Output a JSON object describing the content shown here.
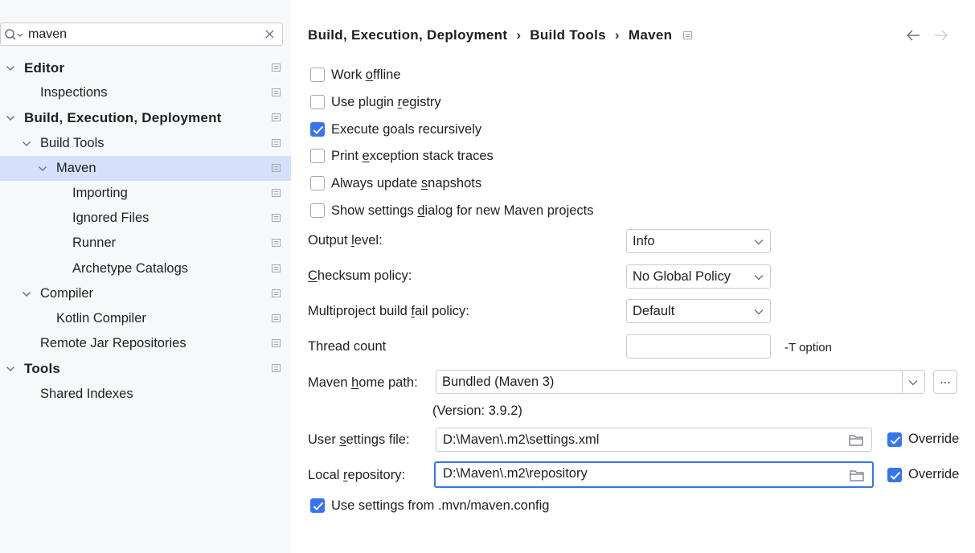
{
  "search": {
    "value": "maven"
  },
  "tree": [
    {
      "label": "Editor",
      "bold": true,
      "chevron": "down",
      "level": 0
    },
    {
      "label": "Inspections",
      "bold": false,
      "chevron": "",
      "level": 1
    },
    {
      "label": "Build, Execution, Deployment",
      "bold": true,
      "chevron": "down",
      "level": 0
    },
    {
      "label": "Build Tools",
      "bold": false,
      "chevron": "down",
      "level": 1
    },
    {
      "label": "Maven",
      "bold": false,
      "chevron": "down",
      "level": 2,
      "selected": true
    },
    {
      "label": "Importing",
      "bold": false,
      "chevron": "",
      "level": 3
    },
    {
      "label": "Ignored Files",
      "bold": false,
      "chevron": "",
      "level": 3
    },
    {
      "label": "Runner",
      "bold": false,
      "chevron": "",
      "level": 3
    },
    {
      "label": "Archetype Catalogs",
      "bold": false,
      "chevron": "",
      "level": 3
    },
    {
      "label": "Compiler",
      "bold": false,
      "chevron": "down",
      "level": 1
    },
    {
      "label": "Kotlin Compiler",
      "bold": false,
      "chevron": "",
      "level": 2
    },
    {
      "label": "Remote Jar Repositories",
      "bold": false,
      "chevron": "",
      "level": 1
    },
    {
      "label": "Tools",
      "bold": true,
      "chevron": "down",
      "level": 0
    },
    {
      "label": "Shared Indexes",
      "bold": false,
      "chevron": "",
      "level": 1
    }
  ],
  "breadcrumb": {
    "items": [
      "Build, Execution, Deployment",
      "Build Tools",
      "Maven"
    ],
    "separator": "›"
  },
  "options": {
    "work_offline": {
      "pre": "Work ",
      "mn": "o",
      "post": "ffline",
      "checked": false
    },
    "plugin_registry": {
      "pre": "Use plugin ",
      "mn": "r",
      "post": "egistry",
      "checked": false
    },
    "execute_goals": {
      "pre": "Execute ",
      "mn": "g",
      "post": "oals recursively",
      "checked": true
    },
    "print_exception": {
      "pre": "Print ",
      "mn": "e",
      "post": "xception stack traces",
      "checked": false
    },
    "update_snapshots": {
      "pre": "Always update ",
      "mn": "s",
      "post": "napshots",
      "checked": false
    },
    "settings_dialog": {
      "pre": "Show settings ",
      "mn": "d",
      "post": "ialog for new Maven projects",
      "checked": false
    }
  },
  "output_level": {
    "pre": "Output ",
    "mn": "l",
    "post": "evel:",
    "value": "Info"
  },
  "checksum_policy": {
    "pre": "",
    "mn": "C",
    "post": "hecksum policy:",
    "value": "No Global Policy"
  },
  "fail_policy": {
    "pre": "Multiproject build ",
    "mn": "f",
    "post": "ail policy:",
    "value": "Default"
  },
  "thread_count": {
    "label": "Thread count",
    "value": "",
    "hint": "-T option"
  },
  "maven_home": {
    "pre": "Maven ",
    "mn": "h",
    "post": "ome path:",
    "value": "Bundled (Maven 3)",
    "browse": "...",
    "version": "(Version: 3.9.2)"
  },
  "user_settings": {
    "pre": "User ",
    "mn": "s",
    "post": "ettings file:",
    "value": "D:\\Maven\\.m2\\settings.xml",
    "override": "Override",
    "override_checked": true
  },
  "local_repo": {
    "pre": "Local ",
    "mn": "r",
    "post": "epository:",
    "value": "D:\\Maven\\.m2\\repository",
    "override": "Override",
    "override_checked": true
  },
  "mvn_config": {
    "label": "Use settings from .mvn/maven.config",
    "checked": true
  },
  "colors": {
    "accent": "#3574f0",
    "selection": "#d5e1fb",
    "sidebar_bg": "#f7f8fa",
    "border": "#c9ccd6"
  }
}
